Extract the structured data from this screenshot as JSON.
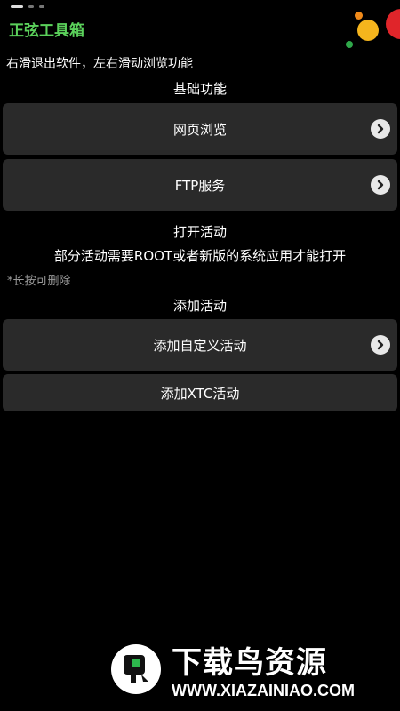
{
  "app": {
    "title": "正弦工具箱",
    "hint": "右滑退出软件，左右滑动浏览功能"
  },
  "basic": {
    "title": "基础功能",
    "items": [
      {
        "label": "网页浏览",
        "chevron": true
      },
      {
        "label": "FTP服务",
        "chevron": true
      }
    ]
  },
  "open_activity": {
    "title": "打开活动",
    "note": "部分活动需要ROOT或者新版的系统应用才能打开",
    "long_press": "*长按可删除"
  },
  "add_activity": {
    "title": "添加活动",
    "items": [
      {
        "label": "添加自定义活动",
        "chevron": true
      },
      {
        "label": "添加XTC活动",
        "chevron": false
      }
    ]
  },
  "watermark": {
    "brand": "下载鸟资源",
    "url": "WWW.XIAZAINIAO.COM"
  },
  "colors": {
    "title_green": "#5bd15b",
    "row_bg": "#2a2a2a",
    "background": "#000000"
  }
}
